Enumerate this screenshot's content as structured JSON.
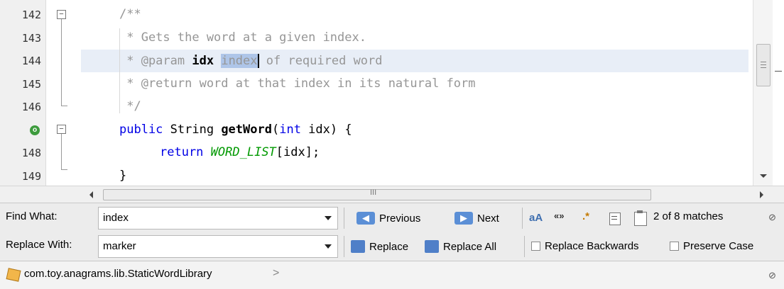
{
  "editor": {
    "line_numbers": [
      "142",
      "143",
      "144",
      "145",
      "146",
      "",
      "148",
      "149"
    ],
    "lines": {
      "l142": "/**",
      "l143": " * Gets the word at a given index.",
      "l144_pre": " * @param ",
      "l144_bold": "idx",
      "l144_sp": " ",
      "l144_match": "index",
      "l144_post": " of required word",
      "l145": " * @return word at that index in its natural form",
      "l146": " */",
      "l147_kw1": "public",
      "l147_t1": " String ",
      "l147_bold": "getWord",
      "l147_t2": "(",
      "l147_kw2": "int",
      "l147_t3": " idx) {",
      "l148_kw": "return",
      "l148_sp": " ",
      "l148_const": "WORD_LIST",
      "l148_tail": "[idx];",
      "l149": "}"
    },
    "override_marker_icon": "override-circle-icon"
  },
  "hscroll": {
    "grip": "III"
  },
  "find": {
    "find_label": "Find What:",
    "find_value": "index",
    "replace_label": "Replace With:",
    "replace_value": "marker",
    "previous_label": "Previous",
    "next_label": "Next",
    "match_case_icon": "aA",
    "whole_words_icon": "«»",
    "regex_icon": ".*",
    "match_status": "2 of 8 matches",
    "replace_label_btn": "Replace",
    "replace_all_label": "Replace All",
    "replace_backwards_label": "Replace Backwards",
    "preserve_case_label": "Preserve Case",
    "close_glyph": "⊘"
  },
  "status": {
    "breadcrumb": "com.toy.anagrams.lib.StaticWordLibrary",
    "close_glyph": "⊘"
  },
  "colors": {
    "keyword": "#0000e6",
    "comment": "#969696",
    "constant": "#009900",
    "match_highlight": "#aec5e8",
    "current_line": "#e8eef7"
  }
}
